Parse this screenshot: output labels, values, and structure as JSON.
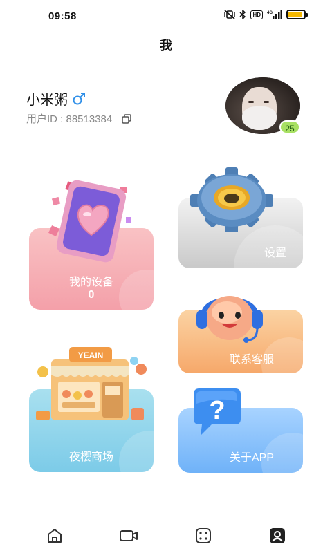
{
  "status_bar": {
    "time": "09:58",
    "hd_label": "HD",
    "network_label": "4G",
    "battery_level": 0.85,
    "battery_color": "#f5b800"
  },
  "header": {
    "title": "我"
  },
  "profile": {
    "name": "小米粥",
    "gender_icon": "male-symbol-icon",
    "gender_color": "#2f8fe8",
    "user_id_label": "用户ID : 88513384",
    "level": "25",
    "level_badge_color": "#a8e063"
  },
  "cards": {
    "devices": {
      "label": "我的设备",
      "count": "0",
      "icon": "device-heart-illustration"
    },
    "settings": {
      "label": "设置",
      "icon": "gear-illustration"
    },
    "support": {
      "label": "联系客服",
      "icon": "headset-mascot-illustration"
    },
    "shop": {
      "label": "夜樱商场",
      "sign": "YEAIN",
      "icon": "shop-storefront-illustration"
    },
    "about": {
      "label": "关于APP",
      "icon": "question-bubble-illustration"
    }
  },
  "bottom_nav": {
    "items": [
      {
        "name": "home",
        "icon": "home-icon",
        "active": false
      },
      {
        "name": "video",
        "icon": "video-camera-icon",
        "active": false
      },
      {
        "name": "dice",
        "icon": "dice-icon",
        "active": false
      },
      {
        "name": "me",
        "icon": "user-icon",
        "active": true
      }
    ]
  }
}
